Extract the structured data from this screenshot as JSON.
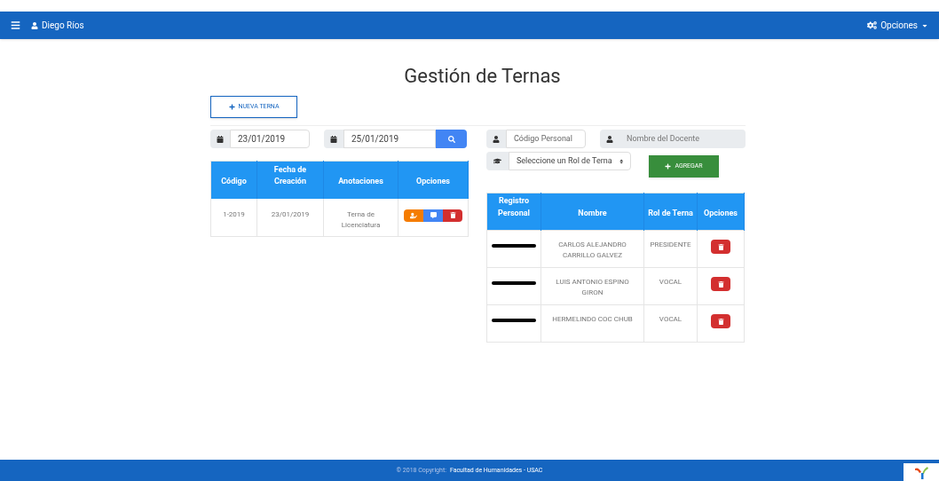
{
  "navbar": {
    "user": "Diego Ríos",
    "options": "Opciones"
  },
  "title": "Gestión de Ternas",
  "new_button": "NUEVA TERNA",
  "date_filter": {
    "from": "23/01/2019",
    "to": "25/01/2019"
  },
  "ternas_table": {
    "columns": [
      "Código",
      "Fecha de Creación",
      "Anotaciones",
      "Opciones"
    ],
    "rows": [
      {
        "codigo": "1-2019",
        "fecha": "23/01/2019",
        "anotaciones": "Terna de Licenciatura"
      }
    ]
  },
  "member_form": {
    "codigo_placeholder": "Código Personal",
    "nombre_placeholder": "Nombre del Docente",
    "rol_select": "Seleccione un Rol de Terna",
    "add_button": "AGREGAR"
  },
  "members_table": {
    "columns": [
      "Registro Personal",
      "Nombre",
      "Rol de Terna",
      "Opciones"
    ],
    "rows": [
      {
        "registro_redacted": true,
        "nombre": "CARLOS ALEJANDRO CARRILLO GALVEZ",
        "rol": "PRESIDENTE"
      },
      {
        "registro_redacted": true,
        "nombre": "LUIS ANTONIO ESPINO GIRON",
        "rol": "VOCAL"
      },
      {
        "registro_redacted": true,
        "nombre": "HERMELINDO COC CHUB",
        "rol": "VOCAL"
      }
    ]
  },
  "footer": {
    "prefix": "© 2018 Copyright:",
    "link": "Facultad de Humanidades - USAC"
  }
}
